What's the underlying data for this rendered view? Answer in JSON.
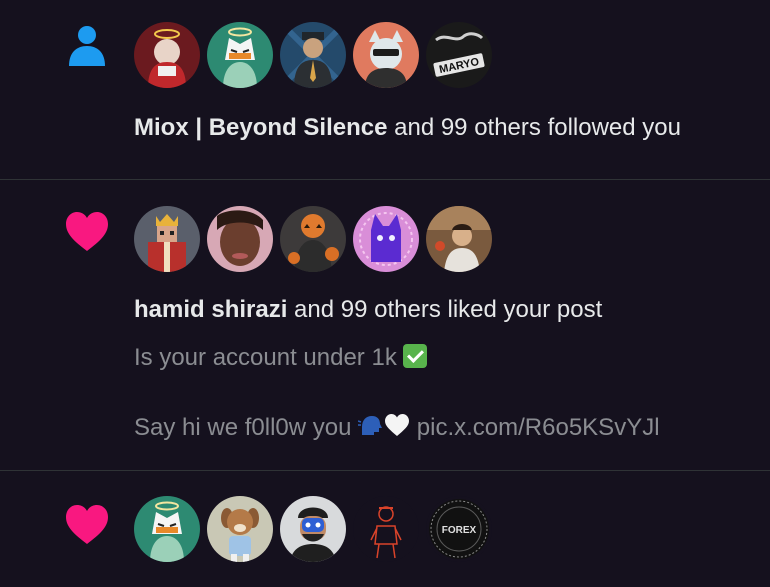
{
  "notifications": [
    {
      "type": "follow",
      "icon": "person-icon",
      "icon_color": "#1d9bf0",
      "avatars": [
        "santa-character-avatar",
        "tiger-helmet-avatar",
        "soldier-portrait-avatar",
        "cat-sunglasses-avatar",
        "maryo-logo-avatar"
      ],
      "actor": "Miox | Beyond Silence",
      "rest": " and 99 others followed you"
    },
    {
      "type": "like",
      "icon": "heart-icon",
      "icon_color": "#f91880",
      "avatars": [
        "pixel-king-avatar",
        "woman-selfie-avatar",
        "pumpkin-girl-avatar",
        "purple-cat-avatar",
        "man-photo-avatar"
      ],
      "actor": "hamid shirazi",
      "rest": " and 99 others liked your post",
      "post_line1": "Is your account under 1k ",
      "post_line2_a": "Say hi we f0ll0w you ",
      "post_line2_b": " pic.x.com/R6o5KSvYJl"
    },
    {
      "type": "like",
      "icon": "heart-icon",
      "icon_color": "#f91880",
      "avatars": [
        "tiger-helmet-avatar",
        "cartoon-dog-avatar",
        "masked-man-avatar",
        "sketch-figure-avatar",
        "forex-logo-avatar"
      ],
      "forex_label": "FOREX"
    }
  ],
  "maryo_label": "MARYO"
}
